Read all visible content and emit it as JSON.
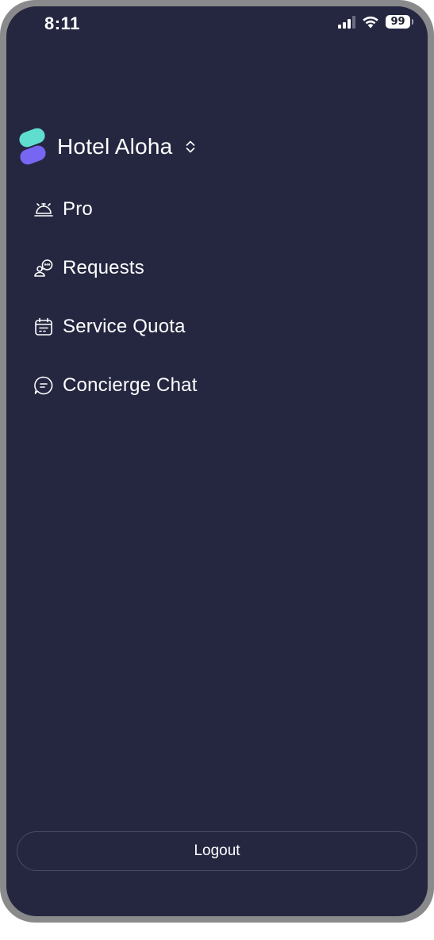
{
  "status_bar": {
    "time": "8:11",
    "battery": "99"
  },
  "header": {
    "hotel_name": "Hotel Aloha",
    "logo_colors": [
      "#5fded0",
      "#7766f2"
    ]
  },
  "menu": {
    "items": [
      {
        "label": "Pro",
        "icon": "service-bell-icon"
      },
      {
        "label": "Requests",
        "icon": "requests-icon"
      },
      {
        "label": "Service Quota",
        "icon": "calendar-icon"
      },
      {
        "label": "Concierge Chat",
        "icon": "chat-bubble-icon"
      }
    ]
  },
  "footer": {
    "logout_label": "Logout"
  },
  "colors": {
    "background": "#252741",
    "text": "#ffffff",
    "border": "#4a4c64"
  }
}
